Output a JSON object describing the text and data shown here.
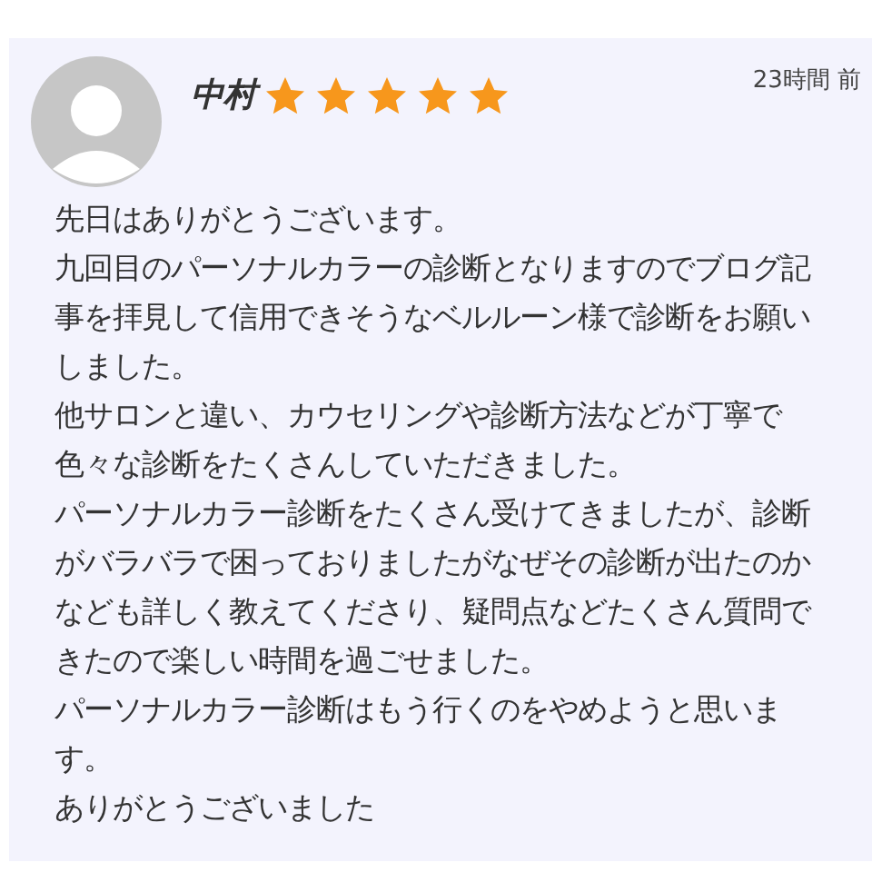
{
  "review": {
    "author": "中村",
    "stars": 5,
    "time": "23時間 前",
    "paragraphs": [
      "先日はありがとうございます。",
      "九回目のパーソナルカラーの診断となりますのでブログ記事を拝見して信用できそうなベルルーン様で診断をお願いしました。",
      "他サロンと違い、カウセリングや診断方法などが丁寧で色々な診断をたくさんしていただきました。",
      "パーソナルカラー診断をたくさん受けてきましたが、診断がバラバラで困っておりましたがなぜその診断が出たのかなども詳しく教えてくださり、疑問点などたくさん質問できたので楽しい時間を過ごせました。",
      "パーソナルカラー診断はもう行くのをやめようと思います。",
      "ありがとうございました"
    ]
  }
}
